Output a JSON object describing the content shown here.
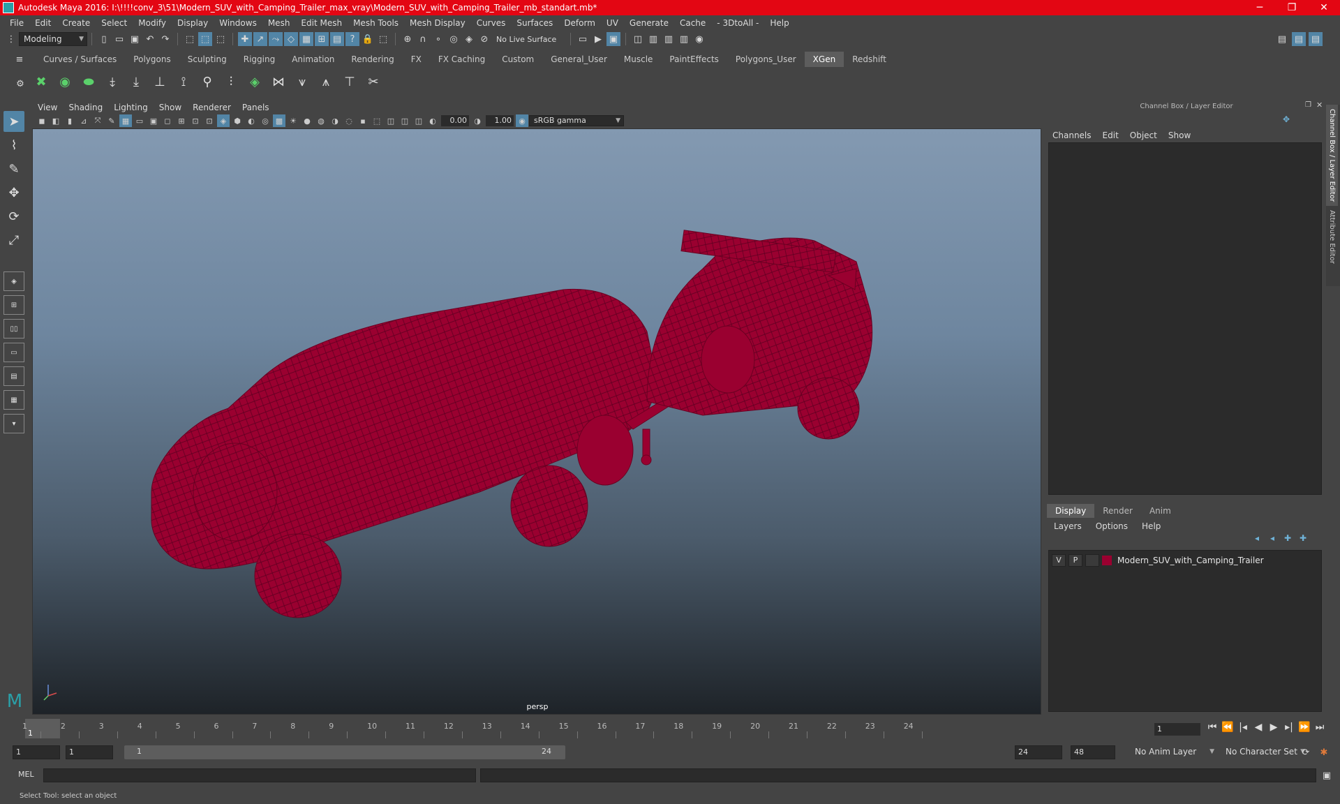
{
  "window": {
    "title": "Autodesk Maya 2016: I:\\!!!!conv_3\\51\\Modern_SUV_with_Camping_Trailer_max_vray\\Modern_SUV_with_Camping_Trailer_mb_standart.mb*",
    "minimize": "─",
    "maximize": "❐",
    "close": "✕"
  },
  "menubar": [
    "File",
    "Edit",
    "Create",
    "Select",
    "Modify",
    "Display",
    "Windows",
    "Mesh",
    "Edit Mesh",
    "Mesh Tools",
    "Mesh Display",
    "Curves",
    "Surfaces",
    "Deform",
    "UV",
    "Generate",
    "Cache",
    "- 3DtoAll -",
    "Help"
  ],
  "statusline": {
    "mode": "Modeling",
    "live_surface": "No Live Surface"
  },
  "shelf": {
    "tabs": [
      "Curves / Surfaces",
      "Polygons",
      "Sculpting",
      "Rigging",
      "Animation",
      "Rendering",
      "FX",
      "FX Caching",
      "Custom",
      "General_User",
      "Muscle",
      "PaintEffects",
      "Polygons_User",
      "XGen",
      "Redshift"
    ],
    "active_tab": "XGen"
  },
  "viewport": {
    "menu": [
      "View",
      "Shading",
      "Lighting",
      "Show",
      "Renderer",
      "Panels"
    ],
    "exposure": "0.00",
    "gamma": "1.00",
    "color_space": "sRGB gamma",
    "camera_label": "persp",
    "wire_color": "#9a0030"
  },
  "channel_box": {
    "header": "Channel Box / Layer Editor",
    "menu": [
      "Channels",
      "Edit",
      "Object",
      "Show"
    ],
    "side_tabs": [
      "Channel Box / Layer Editor",
      "Attribute Editor"
    ]
  },
  "layer_editor": {
    "tabs": [
      "Display",
      "Render",
      "Anim"
    ],
    "active_tab": "Display",
    "menu": [
      "Layers",
      "Options",
      "Help"
    ],
    "layer": {
      "visible": "V",
      "playback": "P",
      "name": "Modern_SUV_with_Camping_Trailer",
      "color": "#9a0030"
    }
  },
  "timeline": {
    "ticks": [
      "1",
      "2",
      "3",
      "4",
      "5",
      "6",
      "7",
      "8",
      "9",
      "10",
      "11",
      "12",
      "13",
      "14",
      "15",
      "16",
      "17",
      "18",
      "19",
      "20",
      "21",
      "22",
      "23",
      "24"
    ],
    "current_marker": "1",
    "current_frame": "1"
  },
  "range": {
    "start": "1",
    "playback_start": "1",
    "slider_start": "1",
    "slider_end": "24",
    "playback_end": "24",
    "end": "48",
    "anim_layer": "No Anim Layer",
    "character_set": "No Character Set"
  },
  "command_line": {
    "label": "MEL"
  },
  "status_message": "Select Tool: select an object"
}
